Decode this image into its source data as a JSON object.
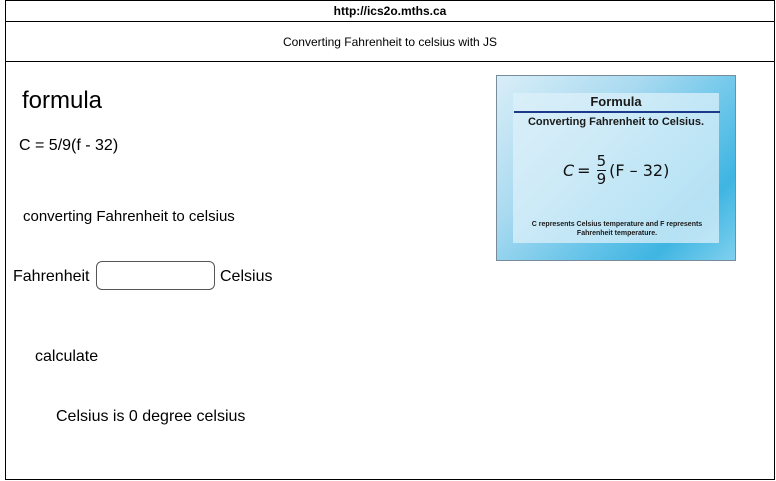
{
  "browser": {
    "url": "http://ics2o.mths.ca"
  },
  "header": {
    "title": "Converting Fahrenheit to celsius with JS"
  },
  "main": {
    "heading": "formula",
    "formula_text": "C = 5/9(f - 32)",
    "subheading": "converting Fahrenheit to celsius",
    "fahrenheit_label": "Fahrenheit",
    "fahrenheit_input": {
      "value": "",
      "placeholder": ""
    },
    "celsius_label": "Celsius",
    "calculate_label": "calculate",
    "result": "Celsius is 0 degree celsius"
  },
  "image": {
    "title": "Formula",
    "subtitle": "Converting Fahrenheit to Celsius.",
    "formula": {
      "lhs": "C",
      "eq": "=",
      "numerator": "5",
      "denominator": "9",
      "rhs": "(F – 32)"
    },
    "note": "C represents Celsius temperature and F represents Fahrenheit temperature."
  },
  "colors": {
    "rule": "#1b3a8c",
    "image_gradient_mid": "#6cc6ea"
  }
}
